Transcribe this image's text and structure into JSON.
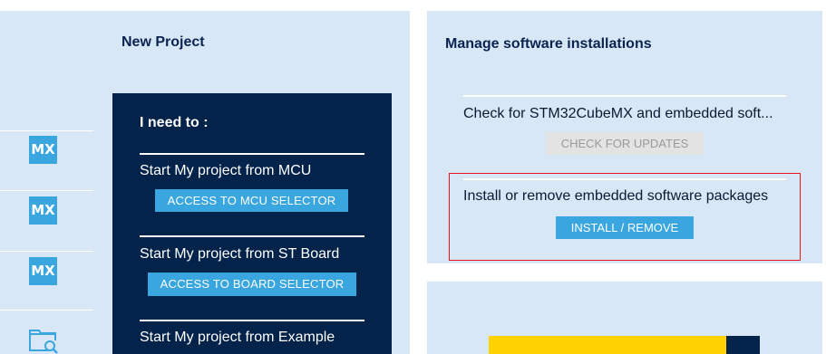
{
  "left_panel": {
    "title": "New Project",
    "mx_icons": [
      {
        "label": "MX"
      },
      {
        "label": "MX"
      },
      {
        "label": "MX"
      }
    ],
    "folder_icon": "folder-search-icon",
    "need_to": "I need to :",
    "options": [
      {
        "label": "Start My project from MCU",
        "button": "ACCESS TO MCU SELECTOR"
      },
      {
        "label": "Start My project from ST Board",
        "button": "ACCESS TO BOARD SELECTOR"
      },
      {
        "label": "Start My project from Example"
      }
    ]
  },
  "right_panel": {
    "title": "Manage software installations",
    "check": {
      "label": "Check for STM32CubeMX and embedded soft...",
      "button": "CHECK FOR UPDATES"
    },
    "install": {
      "label": "Install or remove embedded software packages",
      "button": "INSTALL / REMOVE"
    }
  },
  "colors": {
    "panel_bg": "#d8e7f5",
    "dark_navy": "#03234b",
    "accent_blue": "#3aa6df",
    "highlight_red": "#e8141c",
    "yellow": "#ffd200"
  }
}
